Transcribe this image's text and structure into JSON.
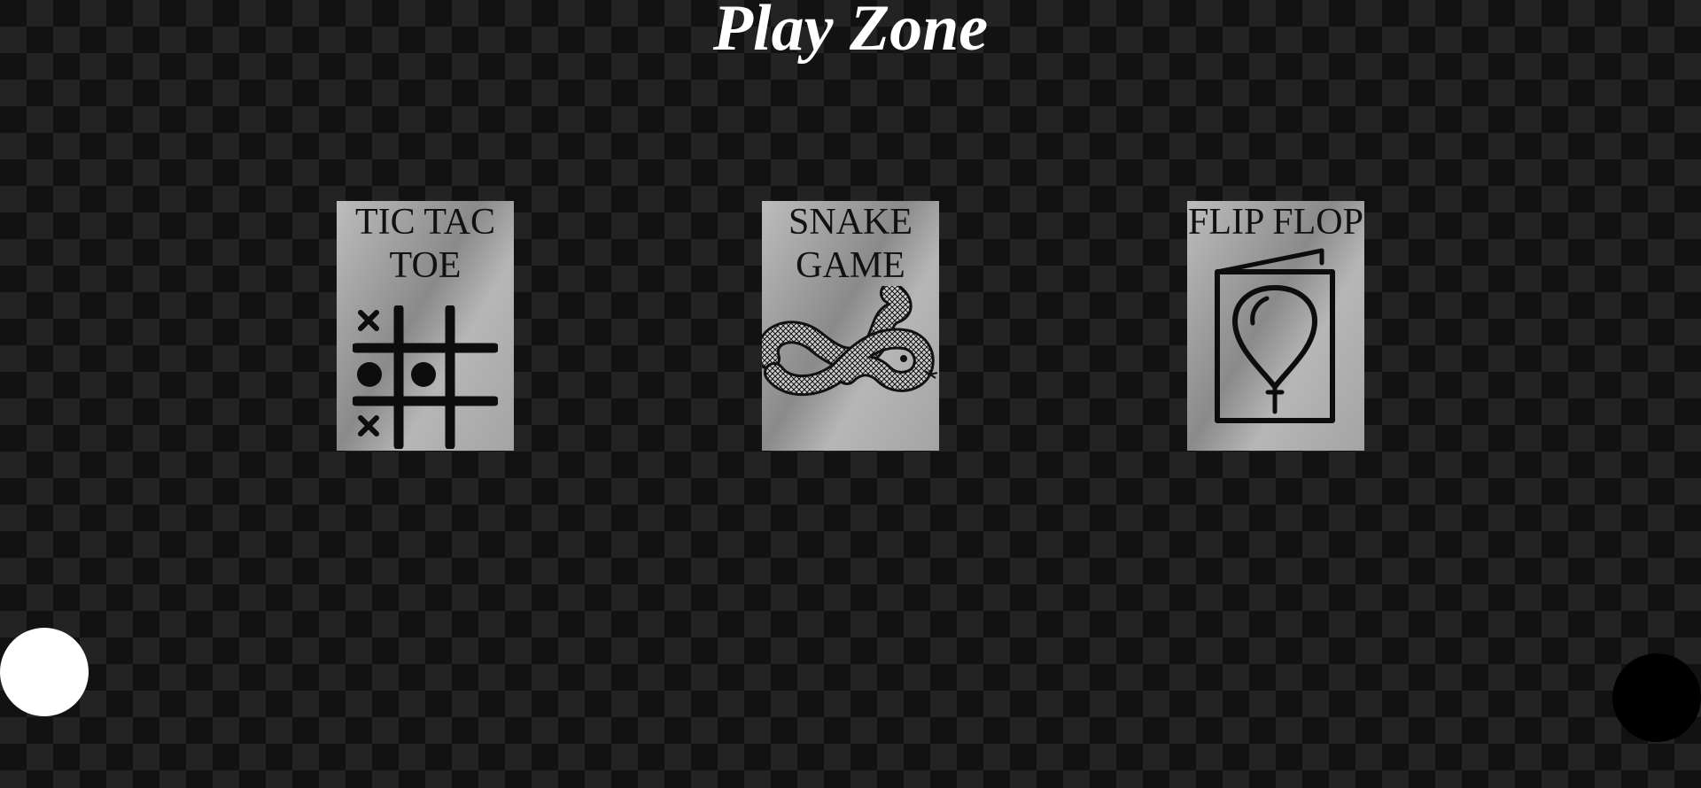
{
  "page": {
    "title": "Play Zone"
  },
  "games": [
    {
      "line1": "TIC TAC",
      "line2": "TOE",
      "icon": "tic-tac-toe-board-icon"
    },
    {
      "line1": "SNAKE",
      "line2": "GAME",
      "icon": "snake-icon"
    },
    {
      "line1": "FLIP FLOP",
      "line2": "",
      "icon": "balloon-card-icon"
    }
  ],
  "theme_toggles": [
    {
      "icon": "light-theme-circle",
      "color": "#ffffff"
    },
    {
      "icon": "dark-theme-circle",
      "color": "#000000"
    }
  ],
  "colors": {
    "background_dark": "#121212",
    "background_light": "#232323",
    "title": "#ffffff",
    "card_text": "#111111"
  }
}
